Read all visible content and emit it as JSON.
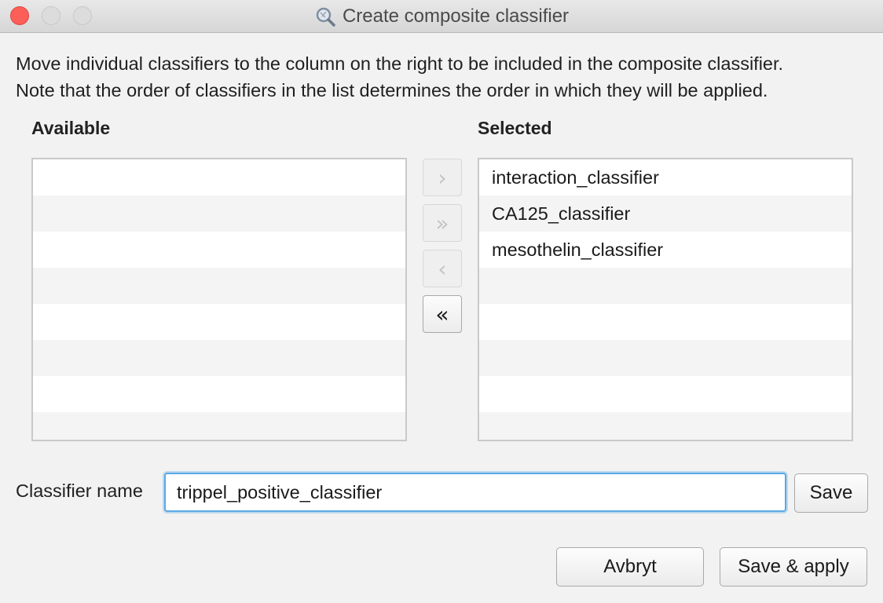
{
  "window": {
    "title": "Create composite classifier",
    "app_icon": "magnifier-app-icon"
  },
  "description": {
    "line1": "Move individual classifiers to the column on the right to be included in the composite classifier.",
    "line2": "Note that the order of classifiers in the list determines the order in which they will be applied."
  },
  "available": {
    "label": "Available",
    "items": []
  },
  "selected": {
    "label": "Selected",
    "items": [
      "interaction_classifier",
      "CA125_classifier",
      "mesothelin_classifier"
    ]
  },
  "move_buttons": {
    "move_right": "›",
    "move_all_right": "»",
    "move_left": "‹",
    "move_all_left": "«"
  },
  "classifier_name": {
    "label": "Classifier name",
    "value": "trippel_positive_classifier",
    "save_label": "Save"
  },
  "footer": {
    "cancel_label": "Avbryt",
    "save_apply_label": "Save & apply"
  },
  "colors": {
    "close": "#fc5f57",
    "focus_ring": "#5aa9e6"
  }
}
